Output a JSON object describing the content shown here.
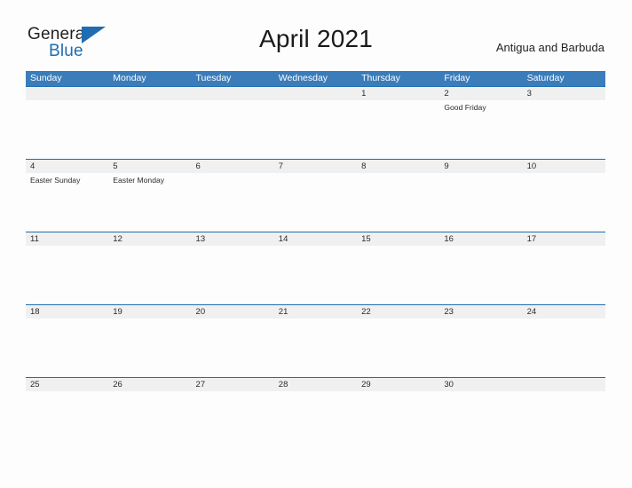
{
  "brand": {
    "name_part1": "General",
    "name_part2": "Blue",
    "flag_icon": "triangle-flag-icon",
    "color_dark": "#231f20",
    "color_blue": "#1f6cb0"
  },
  "header": {
    "title": "April 2021",
    "country": "Antigua and Barbuda"
  },
  "colors": {
    "weekday_header_bg": "#3b7cba",
    "weekday_header_text": "#ffffff",
    "week_banner_bg": "#f0f0f0",
    "week_banner_border": "#1f6cb0",
    "page_bg": "#fdfdfd",
    "text": "#2b2b2b"
  },
  "calendar": {
    "month": "April",
    "year": "2021",
    "weekday_headers": [
      "Sunday",
      "Monday",
      "Tuesday",
      "Wednesday",
      "Thursday",
      "Friday",
      "Saturday"
    ],
    "weeks": [
      {
        "days": [
          {
            "num": "",
            "events": []
          },
          {
            "num": "",
            "events": []
          },
          {
            "num": "",
            "events": []
          },
          {
            "num": "",
            "events": []
          },
          {
            "num": "1",
            "events": []
          },
          {
            "num": "2",
            "events": [
              "Good Friday"
            ]
          },
          {
            "num": "3",
            "events": []
          }
        ]
      },
      {
        "days": [
          {
            "num": "4",
            "events": [
              "Easter Sunday"
            ]
          },
          {
            "num": "5",
            "events": [
              "Easter Monday"
            ]
          },
          {
            "num": "6",
            "events": []
          },
          {
            "num": "7",
            "events": []
          },
          {
            "num": "8",
            "events": []
          },
          {
            "num": "9",
            "events": []
          },
          {
            "num": "10",
            "events": []
          }
        ]
      },
      {
        "days": [
          {
            "num": "11",
            "events": []
          },
          {
            "num": "12",
            "events": []
          },
          {
            "num": "13",
            "events": []
          },
          {
            "num": "14",
            "events": []
          },
          {
            "num": "15",
            "events": []
          },
          {
            "num": "16",
            "events": []
          },
          {
            "num": "17",
            "events": []
          }
        ]
      },
      {
        "days": [
          {
            "num": "18",
            "events": []
          },
          {
            "num": "19",
            "events": []
          },
          {
            "num": "20",
            "events": []
          },
          {
            "num": "21",
            "events": []
          },
          {
            "num": "22",
            "events": []
          },
          {
            "num": "23",
            "events": []
          },
          {
            "num": "24",
            "events": []
          }
        ]
      },
      {
        "days": [
          {
            "num": "25",
            "events": []
          },
          {
            "num": "26",
            "events": []
          },
          {
            "num": "27",
            "events": []
          },
          {
            "num": "28",
            "events": []
          },
          {
            "num": "29",
            "events": []
          },
          {
            "num": "30",
            "events": []
          },
          {
            "num": "",
            "events": []
          }
        ]
      }
    ]
  }
}
